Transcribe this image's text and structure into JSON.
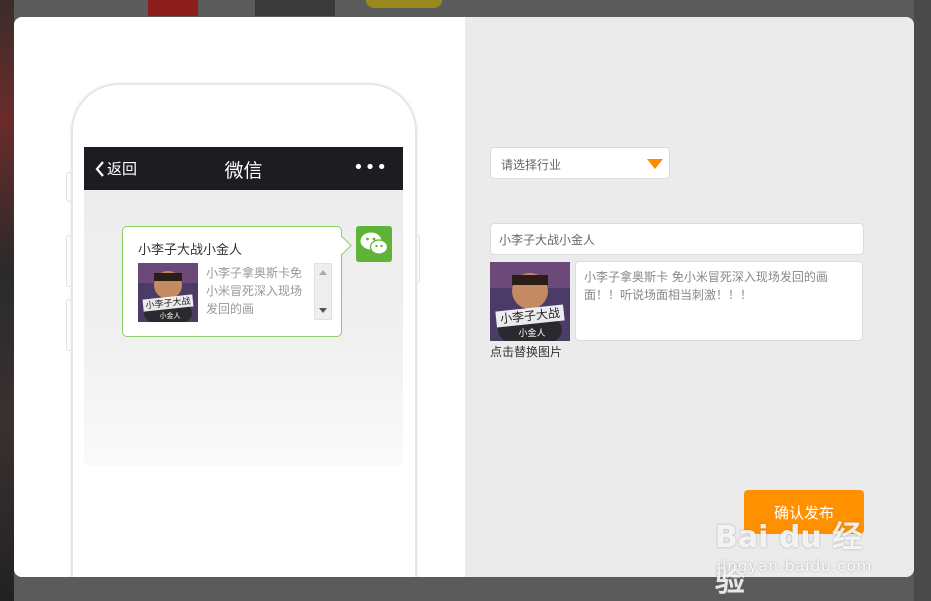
{
  "phone_preview": {
    "nav_back_label": "返回",
    "nav_title": "微信",
    "nav_more": "•••",
    "card_title": "小李子大战小金人",
    "card_description": "小李子拿奥斯卡免小米冒死深入现场发回的画",
    "thumb_caption_line1": "小李子大战",
    "thumb_caption_line2": "小金人"
  },
  "editor": {
    "industry_placeholder": "请选择行业",
    "title_value": "小李子大战小金人",
    "description_value": "小李子拿奥斯卡 免小米冒死深入现场发回的画面！！听说场面相当刺激！！！",
    "replace_image_label": "点击替换图片",
    "confirm_label": "确认发布"
  },
  "watermark": {
    "brand": "Bai du 经验",
    "url": "jingyan.baidu.com"
  },
  "colors": {
    "accent_orange": "#ff9100",
    "wechat_green": "#5fb336",
    "navbar_dark": "#1d1c21"
  }
}
